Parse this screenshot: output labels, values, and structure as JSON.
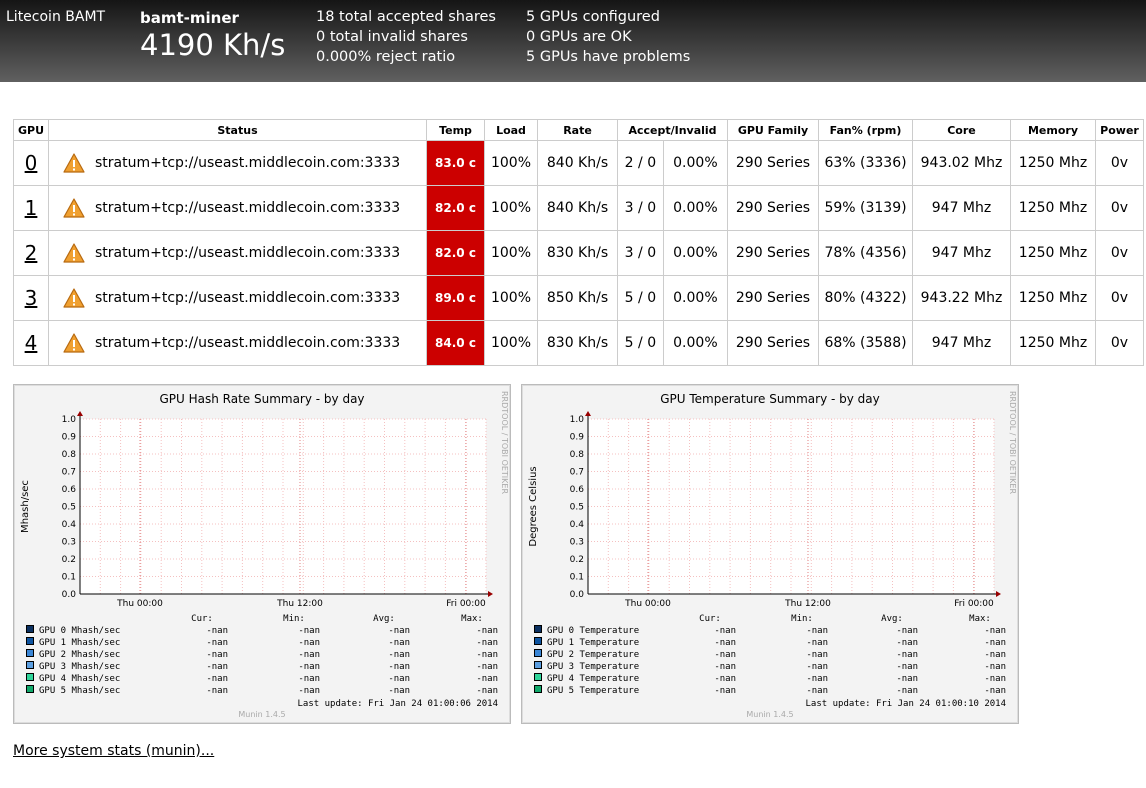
{
  "header": {
    "app": "Litecoin BAMT",
    "host": "bamt-miner",
    "rate": "4190 Kh/s",
    "shares": [
      "18 total accepted shares",
      "0 total invalid shares",
      "0.000% reject ratio"
    ],
    "gpus": [
      "5 GPUs configured",
      "0 GPUs are OK",
      "5 GPUs have problems"
    ]
  },
  "table": {
    "headers": [
      "GPU",
      "Status",
      "Temp",
      "Load",
      "Rate",
      "Accept/Invalid",
      "GPU Family",
      "Fan% (rpm)",
      "Core",
      "Memory",
      "Power"
    ],
    "rows": [
      [
        "0",
        "stratum+tcp://useast.middlecoin.com:3333",
        "83.0 c",
        "100%",
        "840 Kh/s",
        "2 / 0",
        "0.00%",
        "290 Series",
        "63% (3336)",
        "943.02 Mhz",
        "1250 Mhz",
        "0v"
      ],
      [
        "1",
        "stratum+tcp://useast.middlecoin.com:3333",
        "82.0 c",
        "100%",
        "840 Kh/s",
        "3 / 0",
        "0.00%",
        "290 Series",
        "59% (3139)",
        "947 Mhz",
        "1250 Mhz",
        "0v"
      ],
      [
        "2",
        "stratum+tcp://useast.middlecoin.com:3333",
        "82.0 c",
        "100%",
        "830 Kh/s",
        "3 / 0",
        "0.00%",
        "290 Series",
        "78% (4356)",
        "947 Mhz",
        "1250 Mhz",
        "0v"
      ],
      [
        "3",
        "stratum+tcp://useast.middlecoin.com:3333",
        "89.0 c",
        "100%",
        "850 Kh/s",
        "5 / 0",
        "0.00%",
        "290 Series",
        "80% (4322)",
        "943.22 Mhz",
        "1250 Mhz",
        "0v"
      ],
      [
        "4",
        "stratum+tcp://useast.middlecoin.com:3333",
        "84.0 c",
        "100%",
        "830 Kh/s",
        "5 / 0",
        "0.00%",
        "290 Series",
        "68% (3588)",
        "947 Mhz",
        "1250 Mhz",
        "0v"
      ]
    ]
  },
  "chart_data": [
    {
      "type": "line",
      "title": "GPU Hash Rate Summary - by day",
      "ylabel": "Mhash/sec",
      "ylim": [
        0,
        1
      ],
      "yticks": [
        "0.0",
        "0.1",
        "0.2",
        "0.3",
        "0.4",
        "0.5",
        "0.6",
        "0.7",
        "0.8",
        "0.9",
        "1.0"
      ],
      "xticks": [
        "Thu 00:00",
        "Thu 12:00",
        "Fri 00:00"
      ],
      "side": "RRDTOOL / TOBI OETIKER",
      "cols": [
        "Cur:",
        "Min:",
        "Avg:",
        "Max:"
      ],
      "series": [
        {
          "name": "GPU 0 Mhash/sec",
          "color": "#0b3060",
          "values": [
            "-nan",
            "-nan",
            "-nan",
            "-nan"
          ]
        },
        {
          "name": "GPU 1 Mhash/sec",
          "color": "#0e54a0",
          "values": [
            "-nan",
            "-nan",
            "-nan",
            "-nan"
          ]
        },
        {
          "name": "GPU 2 Mhash/sec",
          "color": "#3a86d6",
          "values": [
            "-nan",
            "-nan",
            "-nan",
            "-nan"
          ]
        },
        {
          "name": "GPU 3 Mhash/sec",
          "color": "#5b9ee0",
          "values": [
            "-nan",
            "-nan",
            "-nan",
            "-nan"
          ]
        },
        {
          "name": "GPU 4 Mhash/sec",
          "color": "#2fd49a",
          "values": [
            "-nan",
            "-nan",
            "-nan",
            "-nan"
          ]
        },
        {
          "name": "GPU 5 Mhash/sec",
          "color": "#10a86a",
          "values": [
            "-nan",
            "-nan",
            "-nan",
            "-nan"
          ]
        }
      ],
      "last_update": "Last update:  Fri Jan 24 01:00:06 2014",
      "footer": "Munin 1.4.5"
    },
    {
      "type": "line",
      "title": "GPU Temperature Summary - by day",
      "ylabel": "Degrees Celsius",
      "ylim": [
        0,
        1
      ],
      "yticks": [
        "0.0",
        "0.1",
        "0.2",
        "0.3",
        "0.4",
        "0.5",
        "0.6",
        "0.7",
        "0.8",
        "0.9",
        "1.0"
      ],
      "xticks": [
        "Thu 00:00",
        "Thu 12:00",
        "Fri 00:00"
      ],
      "side": "RRDTOOL / TOBI OETIKER",
      "cols": [
        "Cur:",
        "Min:",
        "Avg:",
        "Max:"
      ],
      "series": [
        {
          "name": "GPU 0 Temperature",
          "color": "#0b3060",
          "values": [
            "-nan",
            "-nan",
            "-nan",
            "-nan"
          ]
        },
        {
          "name": "GPU 1 Temperature",
          "color": "#0e54a0",
          "values": [
            "-nan",
            "-nan",
            "-nan",
            "-nan"
          ]
        },
        {
          "name": "GPU 2 Temperature",
          "color": "#3a86d6",
          "values": [
            "-nan",
            "-nan",
            "-nan",
            "-nan"
          ]
        },
        {
          "name": "GPU 3 Temperature",
          "color": "#5b9ee0",
          "values": [
            "-nan",
            "-nan",
            "-nan",
            "-nan"
          ]
        },
        {
          "name": "GPU 4 Temperature",
          "color": "#2fd49a",
          "values": [
            "-nan",
            "-nan",
            "-nan",
            "-nan"
          ]
        },
        {
          "name": "GPU 5 Temperature",
          "color": "#10a86a",
          "values": [
            "-nan",
            "-nan",
            "-nan",
            "-nan"
          ]
        }
      ],
      "last_update": "Last update:  Fri Jan 24 01:00:10 2014",
      "footer": "Munin 1.4.5"
    }
  ],
  "more_link": "More system stats (munin)..."
}
